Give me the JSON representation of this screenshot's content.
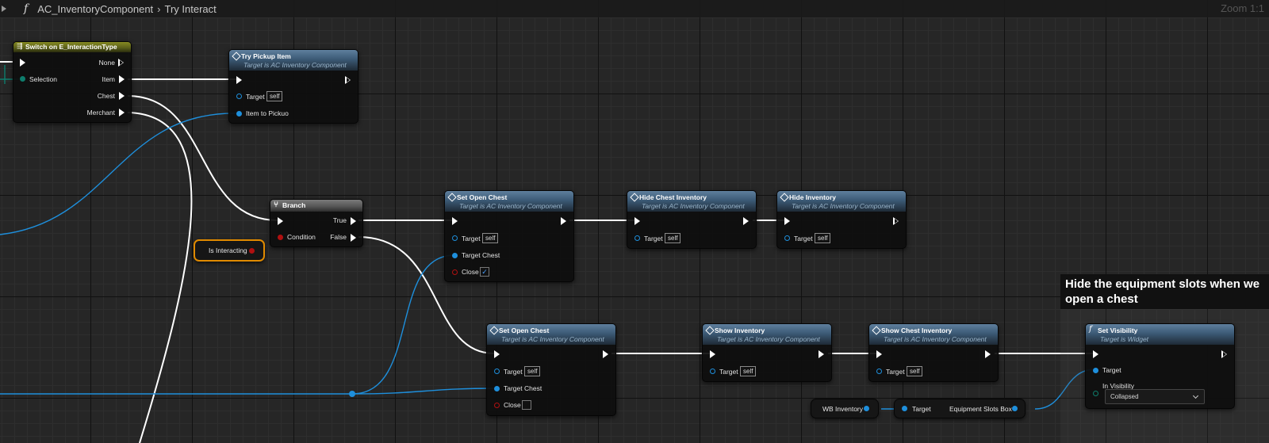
{
  "breadcrumb": {
    "component": "AC_InventoryComponent",
    "separator": "›",
    "function": "Try Interact",
    "zoom": "Zoom 1:1"
  },
  "nodes": {
    "switch": {
      "title": "Switch on E_InteractionType",
      "selection_label": "Selection",
      "outputs": [
        "None",
        "Item",
        "Chest",
        "Merchant"
      ]
    },
    "try_pickup": {
      "title": "Try Pickup Item",
      "subtitle": "Target is AC Inventory Component",
      "target_label": "Target",
      "target_value": "self",
      "item_label": "Item to Pickuo"
    },
    "branch": {
      "title": "Branch",
      "condition_label": "Condition",
      "true_label": "True",
      "false_label": "False"
    },
    "is_interacting": {
      "label": "Is Interacting"
    },
    "set_open_chest_top": {
      "title": "Set Open Chest",
      "subtitle": "Target is AC Inventory Component",
      "target_label": "Target",
      "target_value": "self",
      "chest_label": "Target Chest",
      "close_label": "Close",
      "close_checked": true
    },
    "hide_chest_inventory": {
      "title": "Hide Chest Inventory",
      "subtitle": "Target is AC Inventory Component",
      "target_label": "Target",
      "target_value": "self"
    },
    "hide_inventory": {
      "title": "Hide Inventory",
      "subtitle": "Target is AC Inventory Component",
      "target_label": "Target",
      "target_value": "self"
    },
    "set_open_chest_bottom": {
      "title": "Set Open Chest",
      "subtitle": "Target is AC Inventory Component",
      "target_label": "Target",
      "target_value": "self",
      "chest_label": "Target Chest",
      "close_label": "Close",
      "close_checked": false
    },
    "show_inventory": {
      "title": "Show Inventory",
      "subtitle": "Target is AC Inventory Component",
      "target_label": "Target",
      "target_value": "self"
    },
    "show_chest_inventory": {
      "title": "Show Chest Inventory",
      "subtitle": "Target is AC Inventory Component",
      "target_label": "Target",
      "target_value": "self"
    },
    "wb_inventory": {
      "label": "WB Inventory"
    },
    "equipment_slots": {
      "target_label": "Target",
      "label": "Equipment Slots Box"
    },
    "set_visibility": {
      "title": "Set Visibility",
      "subtitle": "Target is Widget",
      "target_label": "Target",
      "visibility_label": "In Visibility",
      "visibility_value": "Collapsed"
    }
  },
  "comment": {
    "text": "Hide the equipment slots when we open a chest"
  },
  "colors": {
    "exec_wire": "#ffffff",
    "object_wire": "#1e8fdc",
    "bool_pin": "#b01010",
    "enum_pin": "#0e7d6c",
    "selection_outline": "#e08a00",
    "function_header": "#3c5a76",
    "switch_header": "#868a22"
  },
  "icons": [
    "play-arrow-icon",
    "function-icon",
    "function-call-icon",
    "switch-icon",
    "branch-icon",
    "chevron-down-icon",
    "checkmark-icon"
  ]
}
